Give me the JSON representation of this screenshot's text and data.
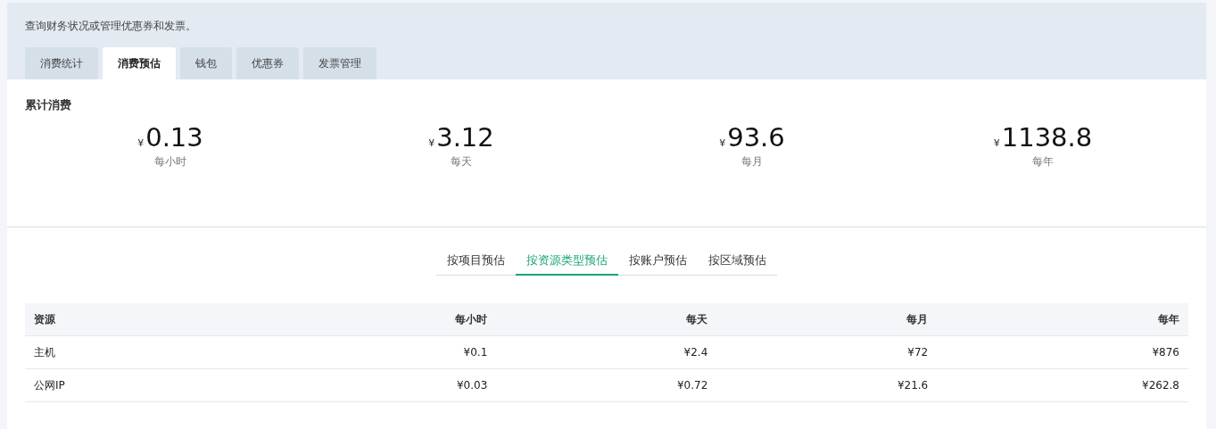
{
  "description": "查询财务状况或管理优惠券和发票。",
  "tabs": [
    {
      "label": "消费统计",
      "selected": false
    },
    {
      "label": "消费预估",
      "selected": true
    },
    {
      "label": "钱包",
      "selected": false
    },
    {
      "label": "优惠券",
      "selected": false
    },
    {
      "label": "发票管理",
      "selected": false
    }
  ],
  "summary": {
    "title": "累计消费",
    "stats": [
      {
        "currency": "¥",
        "value": "0.13",
        "label": "每小时"
      },
      {
        "currency": "¥",
        "value": "3.12",
        "label": "每天"
      },
      {
        "currency": "¥",
        "value": "93.6",
        "label": "每月"
      },
      {
        "currency": "¥",
        "value": "1138.8",
        "label": "每年"
      }
    ]
  },
  "sub_tabs": [
    {
      "label": "按项目预估",
      "selected": false
    },
    {
      "label": "按资源类型预估",
      "selected": true
    },
    {
      "label": "按账户预估",
      "selected": false
    },
    {
      "label": "按区域预估",
      "selected": false
    }
  ],
  "table": {
    "columns": [
      "资源",
      "每小时",
      "每天",
      "每月",
      "每年"
    ],
    "rows": [
      [
        "主机",
        "¥0.1",
        "¥2.4",
        "¥72",
        "¥876"
      ],
      [
        "公网IP",
        "¥0.03",
        "¥0.72",
        "¥21.6",
        "¥262.8"
      ]
    ]
  }
}
